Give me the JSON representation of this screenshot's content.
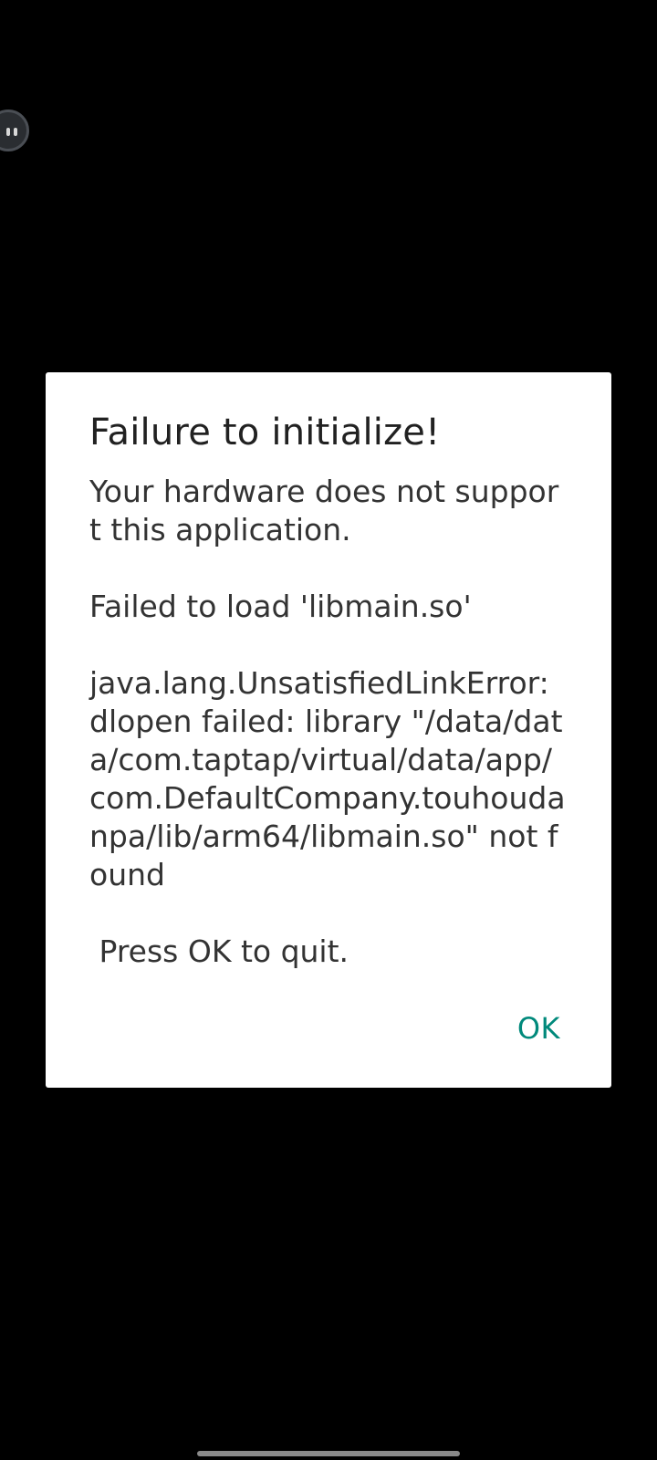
{
  "dialog": {
    "title": "Failure to initialize!",
    "message": "Your hardware does not support this application.\n\nFailed to load 'libmain.so'\n\njava.lang.UnsatisfiedLinkError: dlopen failed: library \"/data/data/com.taptap/virtual/data/app/com.DefaultCompany.touhoudanpa/lib/arm64/libmain.so\" not found\n\n Press OK to quit.",
    "ok_label": "OK"
  },
  "overlay": {
    "floating_icon": "chat-bubble-icon"
  },
  "system": {
    "nav_handle": "gesture-handle"
  },
  "colors": {
    "background": "#000000",
    "dialog_bg": "#ffffff",
    "accent": "#00897b"
  }
}
